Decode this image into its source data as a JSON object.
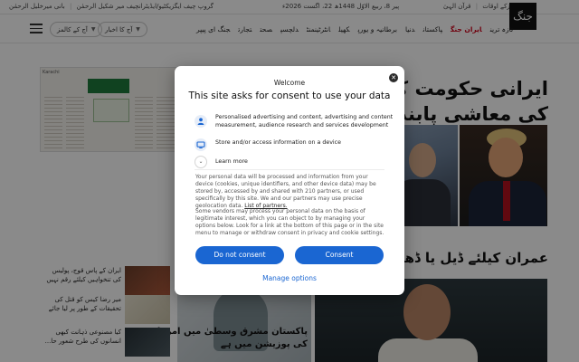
{
  "topbar": {
    "left_text": "بانی میرخلیل الرحمٰن",
    "left_text_2": "گروپ چیف ایگزیکٹیو/ایڈیٹرانچیف میر شکیل الرحمٰن",
    "date_text": "پیر 8، ربیع الاوّل 1448ھ 22، اگست 2026ء",
    "prayer_times": "نمازکے اوقات",
    "quran": "قرآن الہیٰ"
  },
  "logo": {
    "text": "جنگ"
  },
  "nav": {
    "pill_today": "آج کا اخبار",
    "pill_columns": "آج کے کالمز",
    "menu": [
      "تازہ ترین",
      "ایران جنگ",
      "پاکستان",
      "دنیا",
      "برطانیہ و یورپ",
      "کھیل",
      "انٹرٹینمنٹ",
      "دلچسپ",
      "صحت",
      "تجارت",
      "جنگ ای پیپر"
    ],
    "active_index": 1
  },
  "content": {
    "paper_tag": "Karachi",
    "main_headline_1": "ایرانی حکومت کے",
    "main_headline_2": "کی معاشی پابندیو",
    "second_headline": "عمران کیلئے ڈیل یا ڈھیل",
    "mid_headline_1": "پاکستان مشرق وسطیٰ میں امن لانے",
    "mid_headline_2": "کی پوزیشن میں ہے",
    "side_items": [
      {
        "line1": "ایران کے پاس قوج، پولیس",
        "line2": "کی تنخواہیں کیلئے رقم نہیں"
      },
      {
        "line1": "میر رضا کیس کو قتل کی",
        "line2": "تحقیقات کے طور پر لیا جائے"
      },
      {
        "line1": "کیا مصنوعی ذہانت کبھی",
        "line2": "انسانوں کی طرح شعور حا..."
      }
    ]
  },
  "consent": {
    "welcome": "Welcome",
    "title": "This site asks for consent to use your data",
    "purposes": [
      {
        "icon": "person-icon",
        "text": "Personalised advertising and content, advertising and content measurement, audience research and services development"
      },
      {
        "icon": "device-icon",
        "text": "Store and/or access information on a device"
      }
    ],
    "learn_more": "Learn more",
    "paragraph_1": "Your personal data will be processed and information from your device (cookies, unique identifiers, and other device data) may be stored by, accessed by and shared with 210 partners, or used specifically by this site. We and our partners may use precise geolocation data.",
    "paragraph_1_link": "List of partners.",
    "paragraph_2": "Some vendors may process your personal data on the basis of legitimate interest, which you can object to by managing your options below. Look for a link at the bottom of this page or in the site menu to manage or withdraw consent in privacy and cookie settings.",
    "btn_do_not_consent": "Do not consent",
    "btn_consent": "Consent",
    "manage_options": "Manage options",
    "accent_color": "#1a66d2"
  }
}
